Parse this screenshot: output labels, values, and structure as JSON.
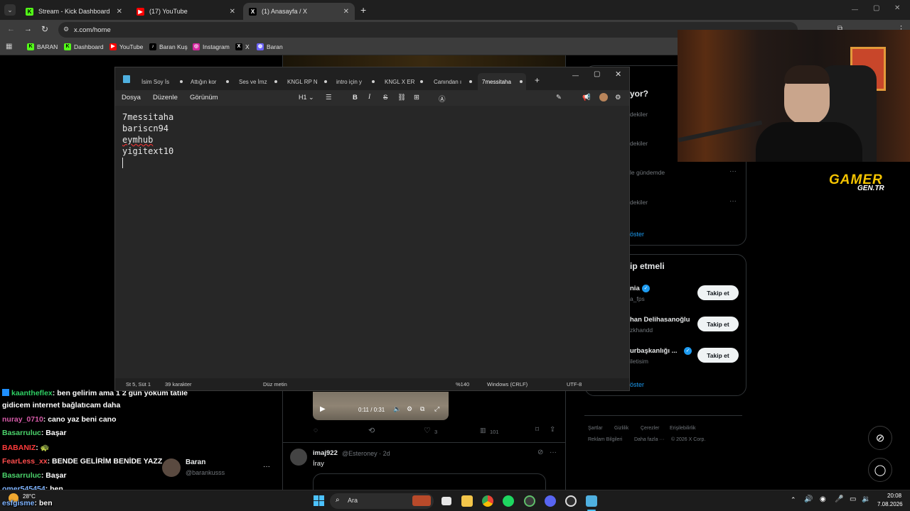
{
  "browser": {
    "tabs": [
      {
        "label": "Stream - Kick Dashboard",
        "icon": "kick-icon"
      },
      {
        "label": "(17) YouTube",
        "icon": "youtube-icon"
      },
      {
        "label": "(1) Anasayfa / X",
        "icon": "x-icon"
      }
    ],
    "new_tab": "+",
    "address": "x.com/home",
    "bookmarks": [
      "BARAN",
      "Dashboard",
      "YouTube",
      "Baran Kuş",
      "Instagram",
      "X",
      "Baran"
    ]
  },
  "notepad": {
    "tabs": [
      "İsim Soy İs",
      "Attığın kor",
      "Ses ve İmz",
      "KNGL RP N",
      "intro için y",
      "KNGL X ER",
      "Canından ı",
      "7messitaha"
    ],
    "menu": [
      "Dosya",
      "Düzenle",
      "Görünüm"
    ],
    "heading_select": "H1",
    "lines": [
      "7messitaha",
      "bariscn94",
      "eymhub",
      "yigitext10"
    ],
    "status": {
      "position": "St 5, Süt 1",
      "chars": "39 karakter",
      "format": "Düz metin",
      "zoom": "%140",
      "eol": "Windows (CRLF)",
      "encoding": "UTF-8"
    }
  },
  "x": {
    "trends_title": "yor?",
    "trend_lines": [
      "dekiler",
      "dekiler",
      "le gündemde",
      "dekiler"
    ],
    "show_more": "öster",
    "follow_title": "ip etmeli",
    "suggestions": [
      {
        "name": "nia",
        "handle": "a_fps"
      },
      {
        "name": "han Delihasanoğlu",
        "handle": "zkhandd"
      },
      {
        "name": "urbaşkanlığı ...",
        "handle": "iletisim"
      }
    ],
    "follow_label": "Takip et",
    "show_more_2": "öster",
    "footer": [
      "Şartlar",
      "Gizlilik",
      "Çerezler",
      "Erişilebilirlik",
      "Reklam Bilgileri",
      "Daha fazla ···",
      "© 2026 X Corp."
    ],
    "video_time": "0:11 / 0:31",
    "post_actions": {
      "retweets": "",
      "likes": "3",
      "views": "101"
    },
    "post": {
      "user": "imaj922",
      "handle": "@Esteroney · 2d",
      "text": "İray"
    },
    "account": {
      "name": "Baran",
      "handle": "@barankusss"
    }
  },
  "overlay": {
    "brand_line1": "GAMER",
    "brand_line2": "GEN.TR",
    "chat": [
      {
        "user": "kaantheflex",
        "msg": ": ben gelirim ama 1 2 gün yokum tatile",
        "color": "#2ecf63"
      },
      {
        "user": "",
        "msg": "gidicem internet bağlatıcam daha",
        "color": "#ffffff"
      },
      {
        "user": "nuray_0710",
        "msg": ": cano yaz beni cano",
        "color": "#d65ba8"
      },
      {
        "user": "Basarruluc",
        "msg": ": Başar",
        "color": "#4bd36b"
      },
      {
        "user": "BABANIZ",
        "msg": ": 🐢",
        "color": "#ff3b3b"
      },
      {
        "user": "FearLess_xx",
        "msg": ": BENDE GELİRİM BENİDE YAZZ",
        "color": "#ff4d4d"
      },
      {
        "user": "Basarruluc",
        "msg": ": Başar",
        "color": "#4bd36b"
      },
      {
        "user": "omer545454",
        "msg": ": ben",
        "color": "#7fb4ff"
      },
      {
        "user": "esfgisme",
        "msg": ": ben",
        "color": "#7fb4ff"
      }
    ]
  },
  "taskbar": {
    "search": "Ara",
    "weather_temp": "28°C",
    "time": "20:08",
    "date": "7.08.2026"
  }
}
